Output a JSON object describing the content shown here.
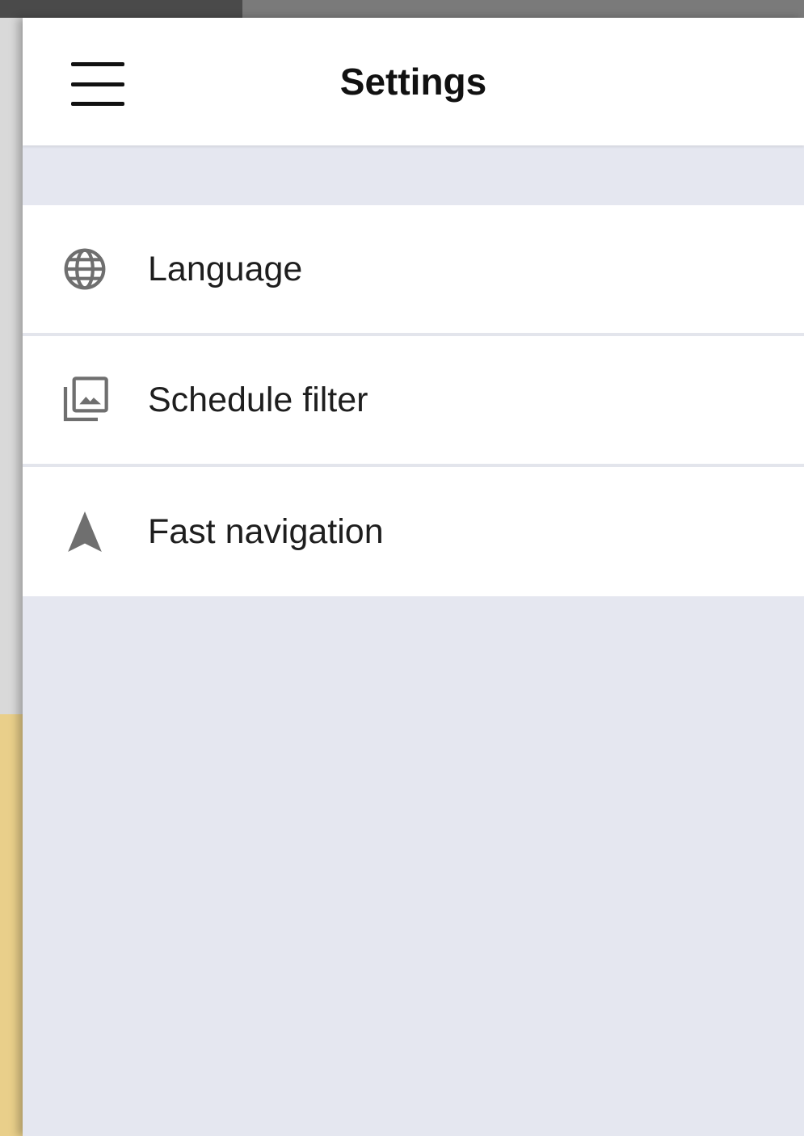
{
  "header": {
    "title": "Settings",
    "menu_icon": "hamburger-menu-icon"
  },
  "settings": {
    "items": [
      {
        "label": "Language",
        "icon": "globe-icon"
      },
      {
        "label": "Schedule filter",
        "icon": "photo-library-icon"
      },
      {
        "label": "Fast navigation",
        "icon": "navigation-arrow-icon"
      }
    ]
  },
  "colors": {
    "drawer_background": "#e5e7f0",
    "surface": "#ffffff",
    "icon": "#6f6f6f",
    "text": "#1e1e1e"
  }
}
